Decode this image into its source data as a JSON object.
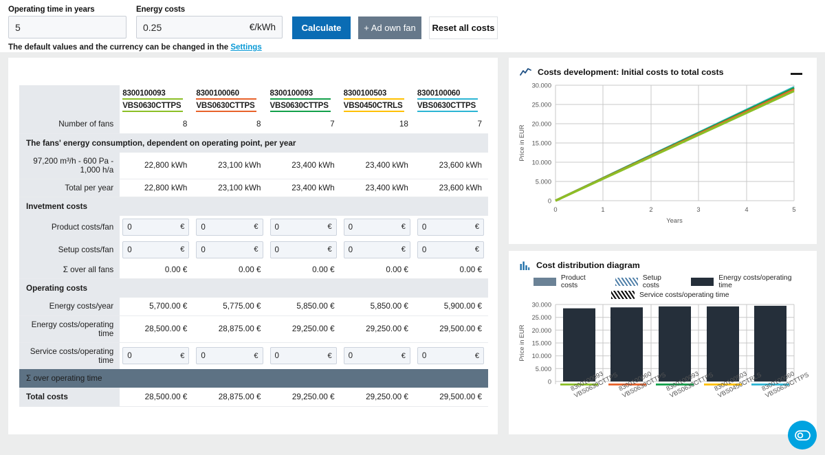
{
  "toolbar": {
    "operating_time": {
      "label": "Operating time in years",
      "value": "5"
    },
    "energy_costs": {
      "label": "Energy costs",
      "value": "0.25",
      "unit": "€/kWh"
    },
    "calculate_label": "Calculate",
    "add_own_fan_label": "+ Ad own fan",
    "reset_label": "Reset all costs",
    "hint_text": "The default values and the currency can be changed in the ",
    "hint_link": "Settings"
  },
  "colors": {
    "primary_blue": "#0a6cb4",
    "grey_button": "#66788a",
    "link_blue": "#0a9ad6",
    "dark_row": "#5d7284",
    "bar_fill": "#252f3a",
    "product_costs": "#6b8296",
    "fab": "#00a3e0",
    "series": [
      "#8cbf26",
      "#e8622a",
      "#12a04a",
      "#ffc000",
      "#2cb5d4"
    ]
  },
  "table": {
    "columns": [
      {
        "id": "8300100093",
        "type": "VBS0630CTTPS",
        "color": "#8cbf26"
      },
      {
        "id": "8300100060",
        "type": "VBS0630CTTPS",
        "color": "#e8622a"
      },
      {
        "id": "8300100093",
        "type": "VBS0630CTTPS",
        "color": "#12a04a"
      },
      {
        "id": "8300100503",
        "type": "VBS0450CTRLS",
        "color": "#ffc000"
      },
      {
        "id": "8300100060",
        "type": "VBS0630CTTPS",
        "color": "#2cb5d4"
      }
    ],
    "number_of_fans": {
      "label": "Number of fans",
      "values": [
        "8",
        "8",
        "7",
        "18",
        "7"
      ]
    },
    "energy_section_title": "The fans' energy consumption, dependent on operating point, per year",
    "operating_point": {
      "label": "97,200 m³/h - 600 Pa - 1,000 h/a",
      "values": [
        "22,800 kWh",
        "23,100 kWh",
        "23,400 kWh",
        "23,400 kWh",
        "23,600 kWh"
      ]
    },
    "total_per_year": {
      "label": "Total per year",
      "values": [
        "22,800 kWh",
        "23,100 kWh",
        "23,400 kWh",
        "23,400 kWh",
        "23,600 kWh"
      ]
    },
    "investment_section_title": "Invetment costs",
    "product_costs": {
      "label": "Product costs/fan",
      "values": [
        "0",
        "0",
        "0",
        "0",
        "0"
      ],
      "currency": "€"
    },
    "setup_costs": {
      "label": "Setup costs/fan",
      "values": [
        "0",
        "0",
        "0",
        "0",
        "0"
      ],
      "currency": "€"
    },
    "sum_all_fans": {
      "label": "Σ over all fans",
      "values": [
        "0.00 €",
        "0.00 €",
        "0.00 €",
        "0.00 €",
        "0.00 €"
      ]
    },
    "operating_section_title": "Operating costs",
    "energy_costs_year": {
      "label": "Energy costs/year",
      "values": [
        "5,700.00 €",
        "5,775.00 €",
        "5,850.00 €",
        "5,850.00 €",
        "5,900.00 €"
      ]
    },
    "energy_costs_op": {
      "label": "Energy costs/operating time",
      "values": [
        "28,500.00 €",
        "28,875.00 €",
        "29,250.00 €",
        "29,250.00 €",
        "29,500.00 €"
      ]
    },
    "service_costs_op": {
      "label": "Service costs/operating time",
      "values": [
        "0",
        "0",
        "0",
        "0",
        "0"
      ],
      "currency": "€"
    },
    "sum_operating_time_title": "Σ over operating time",
    "total_costs": {
      "label": "Total costs",
      "values": [
        "28,500.00 €",
        "28,875.00 €",
        "29,250.00 €",
        "29,250.00 €",
        "29,500.00 €"
      ]
    }
  },
  "line_chart": {
    "title": "Costs development: Initial costs to total costs",
    "minimize_label": "—"
  },
  "bar_chart": {
    "title": "Cost distribution diagram",
    "legend": [
      {
        "label": "Product costs",
        "style": "solid",
        "color": "#6b8296"
      },
      {
        "label": "Setup costs",
        "style": "hatch",
        "color": "#4f7fa8"
      },
      {
        "label": "Energy costs/operating time",
        "style": "solid",
        "color": "#252f3a"
      },
      {
        "label": "Service costs/operating time",
        "style": "hatch",
        "color": "#111111"
      }
    ]
  },
  "fab": {
    "icon": "cookie-consent-icon"
  },
  "chart_data": [
    {
      "type": "line",
      "title": "Costs development: Initial costs to total costs",
      "xlabel": "Years",
      "ylabel": "Price in EUR",
      "xlim": [
        0,
        5
      ],
      "ylim": [
        0,
        30000
      ],
      "xticks": [
        "0",
        "1",
        "2",
        "3",
        "4",
        "5"
      ],
      "yticks": [
        "0",
        "5.000",
        "10.000",
        "15.000",
        "20.000",
        "25.000",
        "30.000"
      ],
      "grid": true,
      "legend_position": "none",
      "x": [
        0,
        1,
        2,
        3,
        4,
        5
      ],
      "series": [
        {
          "name": "8300100093 VBS0630CTTPS",
          "color": "#8cbf26",
          "values": [
            0,
            5700,
            11400,
            17100,
            22800,
            28500
          ]
        },
        {
          "name": "8300100060 VBS0630CTTPS",
          "color": "#e8622a",
          "values": [
            0,
            5775,
            11550,
            17325,
            23100,
            28875
          ]
        },
        {
          "name": "8300100093 VBS0630CTTPS",
          "color": "#12a04a",
          "values": [
            0,
            5850,
            11700,
            17550,
            23400,
            29250
          ]
        },
        {
          "name": "8300100503 VBS0450CTRLS",
          "color": "#ffc000",
          "values": [
            0,
            5850,
            11700,
            17550,
            23400,
            29250
          ]
        },
        {
          "name": "8300100060 VBS0630CTTPS",
          "color": "#2cb5d4",
          "values": [
            0,
            5900,
            11800,
            17700,
            23600,
            29500
          ]
        }
      ]
    },
    {
      "type": "bar",
      "title": "Cost distribution diagram",
      "xlabel": "",
      "ylabel": "Price in EUR",
      "ylim": [
        0,
        30000
      ],
      "yticks": [
        "0",
        "5.000",
        "10.000",
        "15.000",
        "20.000",
        "25.000",
        "30.000"
      ],
      "grid": true,
      "legend_position": "top",
      "categories": [
        "8300100093 VBS0630CTTPS",
        "8300100060 VBS0630CTTPS",
        "8300100093 VBS0630CTTPS",
        "8300100503 VBS0450CTRLS",
        "8300100060 VBS0630CTTPS"
      ],
      "category_colors": [
        "#8cbf26",
        "#e8622a",
        "#12a04a",
        "#ffc000",
        "#2cb5d4"
      ],
      "series": [
        {
          "name": "Product costs",
          "color": "#6b8296",
          "values": [
            0,
            0,
            0,
            0,
            0
          ]
        },
        {
          "name": "Setup costs",
          "color": "#4f7fa8",
          "values": [
            0,
            0,
            0,
            0,
            0
          ]
        },
        {
          "name": "Energy costs/operating time",
          "color": "#252f3a",
          "values": [
            28500,
            28875,
            29250,
            29250,
            29500
          ]
        },
        {
          "name": "Service costs/operating time",
          "color": "#111111",
          "values": [
            0,
            0,
            0,
            0,
            0
          ]
        }
      ]
    }
  ]
}
